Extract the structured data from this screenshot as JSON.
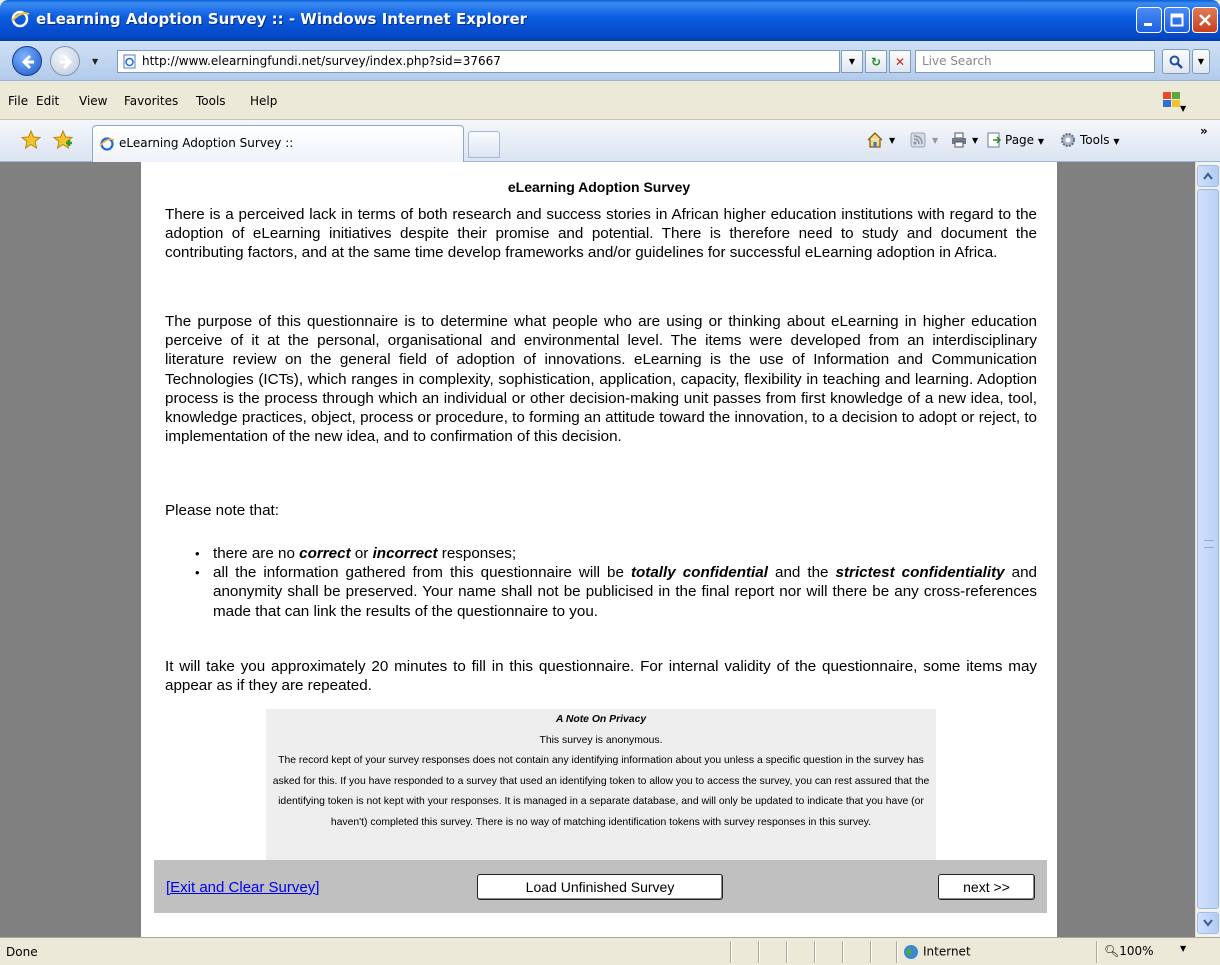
{
  "window": {
    "title": "eLearning Adoption Survey :: - Windows Internet Explorer"
  },
  "address": {
    "url": "http://www.elearningfundi.net/survey/index.php?sid=37667",
    "search_placeholder": "Live Search"
  },
  "menu": {
    "items": [
      "File",
      "Edit",
      "View",
      "Favorites",
      "Tools",
      "Help"
    ]
  },
  "tabs": {
    "active_label": "eLearning Adoption Survey ::"
  },
  "commands": {
    "page_label": "Page",
    "tools_label": "Tools"
  },
  "survey": {
    "title": "eLearning Adoption Survey",
    "p1": "There is a perceived lack in terms of both research and success stories in African higher education institutions with regard to the adoption of eLearning initiatives despite their promise and potential. There is therefore need to study and document the contributing factors, and at the same time develop frameworks and/or guidelines for successful eLearning adoption in Africa.",
    "p2": "The purpose of this questionnaire is to determine what people who are using or thinking about eLearning in higher education perceive of it at the personal, organisational and environmental level. The items were developed from an interdisciplinary literature review on the general field of adoption of innovations. eLearning is the use of Information and Communication Technologies (ICTs), which ranges in complexity, sophistication, application, capacity, flexibility in teaching and learning. Adoption process is the process through which an individual or other decision-making unit passes from first knowledge of a new idea, tool, knowledge practices, object, process or procedure, to forming an attitude toward the innovation, to a decision to adopt or reject, to implementation of the new idea, and to confirmation of this decision.",
    "p3": "Please note that:",
    "bullet1": {
      "a": "there are no ",
      "b": "correct",
      "c": " or ",
      "d": "incorrect",
      "e": " responses;"
    },
    "bullet2": {
      "a": "all the information gathered from this questionnaire will be ",
      "b": "totally confidential",
      "c": " and the ",
      "d": "strictest confidentiality",
      "e": " and anonymity shall be preserved. Your name shall not be publicised in the final report nor will there be any cross-references made that can link the results of the questionnaire to you."
    },
    "p4": "It will take you approximately 20 minutes to fill in this questionnaire. For internal validity of the questionnaire, some items may appear as if they are repeated."
  },
  "privacy": {
    "title": "A Note On Privacy",
    "line1": "This survey is anonymous.",
    "body": "The record kept of your survey responses does not contain any identifying information about you unless a specific question in the survey has asked for this. If you have responded to a survey that used an identifying token to allow you to access the survey, you can rest assured that the identifying token is not kept with your responses. It is managed in a separate database, and will only be updated to indicate that you have (or haven't) completed this survey. There is no way of matching identification tokens with survey responses in this survey."
  },
  "nav": {
    "exit_label": "[Exit and Clear Survey]",
    "load_label": "Load Unfinished Survey",
    "next_label": "next >>"
  },
  "status": {
    "text": "Done",
    "zone": "Internet",
    "zoom": "100%"
  },
  "colors": {
    "link": "#0000ee",
    "page_bg": "#808080",
    "titlebar": "#0c5ee0"
  }
}
